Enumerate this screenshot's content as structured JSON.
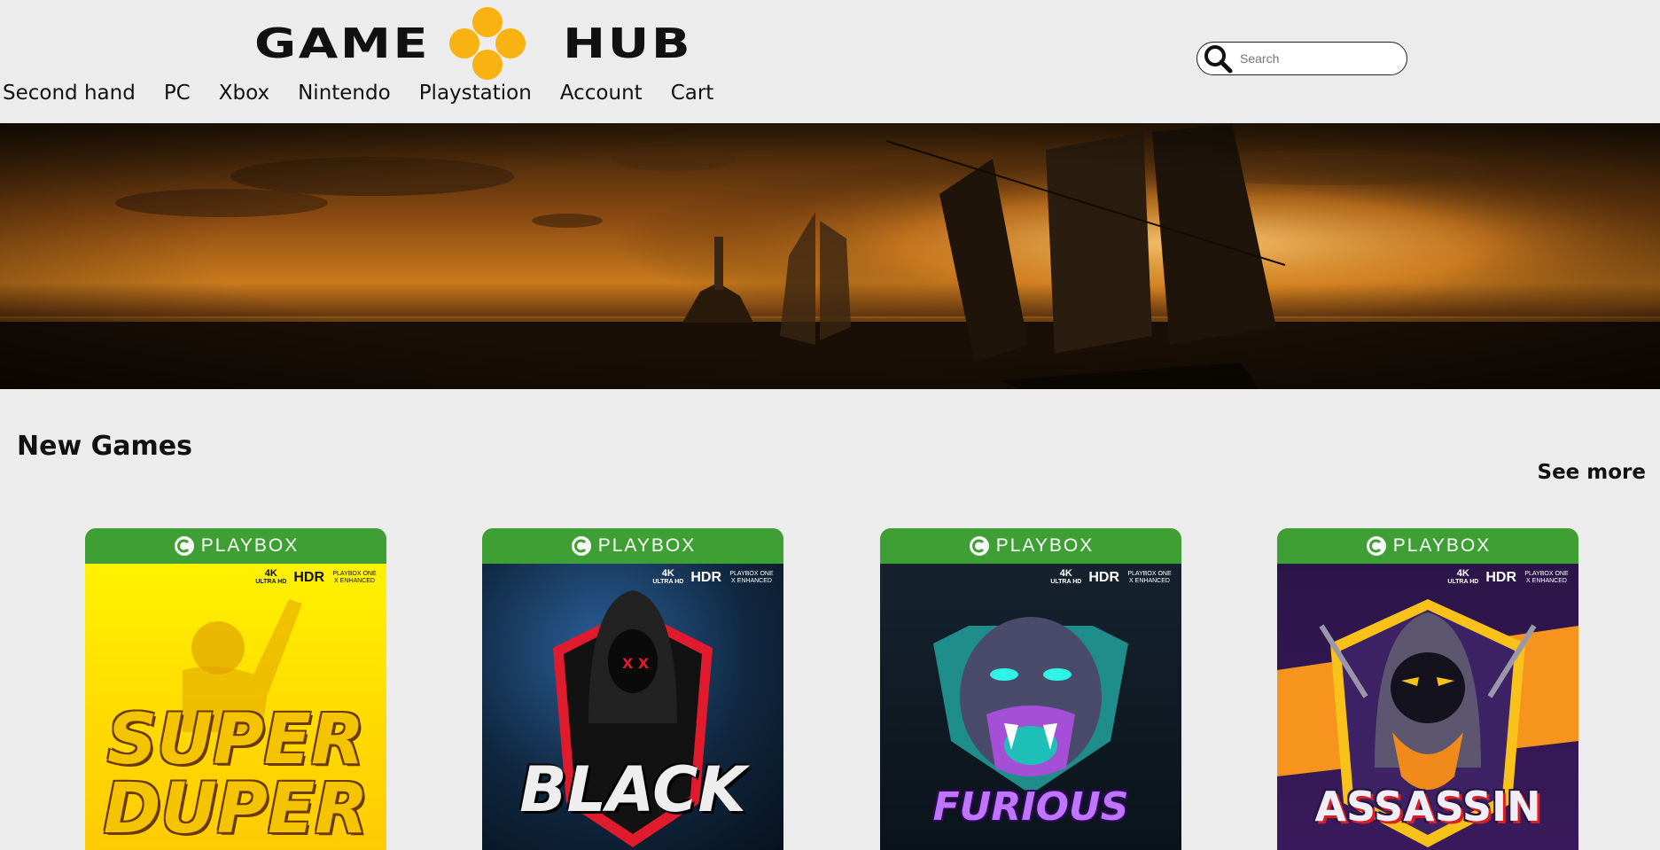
{
  "logo": {
    "left_text": "GAME",
    "right_text": "HUB"
  },
  "nav": {
    "items": [
      "Second hand",
      "PC",
      "Xbox",
      "Nintendo",
      "Playstation",
      "Account",
      "Cart"
    ]
  },
  "search": {
    "placeholder": "Search",
    "value": ""
  },
  "section": {
    "title": "New Games",
    "see_more": "See more"
  },
  "cards": [
    {
      "brand": "PLAYBOX",
      "res": "4K",
      "res_sub": "ULTRA HD",
      "hdr": "HDR",
      "enhanced": "PLAYBOX ONE X ENHANCED",
      "title_art": "SUPER DUPER"
    },
    {
      "brand": "PLAYBOX",
      "res": "4K",
      "res_sub": "ULTRA HD",
      "hdr": "HDR",
      "enhanced": "PLAYBOX ONE X ENHANCED",
      "title_art": "BLACK"
    },
    {
      "brand": "PLAYBOX",
      "res": "4K",
      "res_sub": "ULTRA HD",
      "hdr": "HDR",
      "enhanced": "PLAYBOX ONE X ENHANCED",
      "title_art": "FURIOUS"
    },
    {
      "brand": "PLAYBOX",
      "res": "4K",
      "res_sub": "ULTRA HD",
      "hdr": "HDR",
      "enhanced": "PLAYBOX ONE X ENHANCED",
      "title_art": "ASSASSIN"
    }
  ],
  "colors": {
    "accent": "#f8b312",
    "brand_green": "#3ea034",
    "background": "#ececec"
  },
  "icons": {
    "search": "search-icon"
  }
}
